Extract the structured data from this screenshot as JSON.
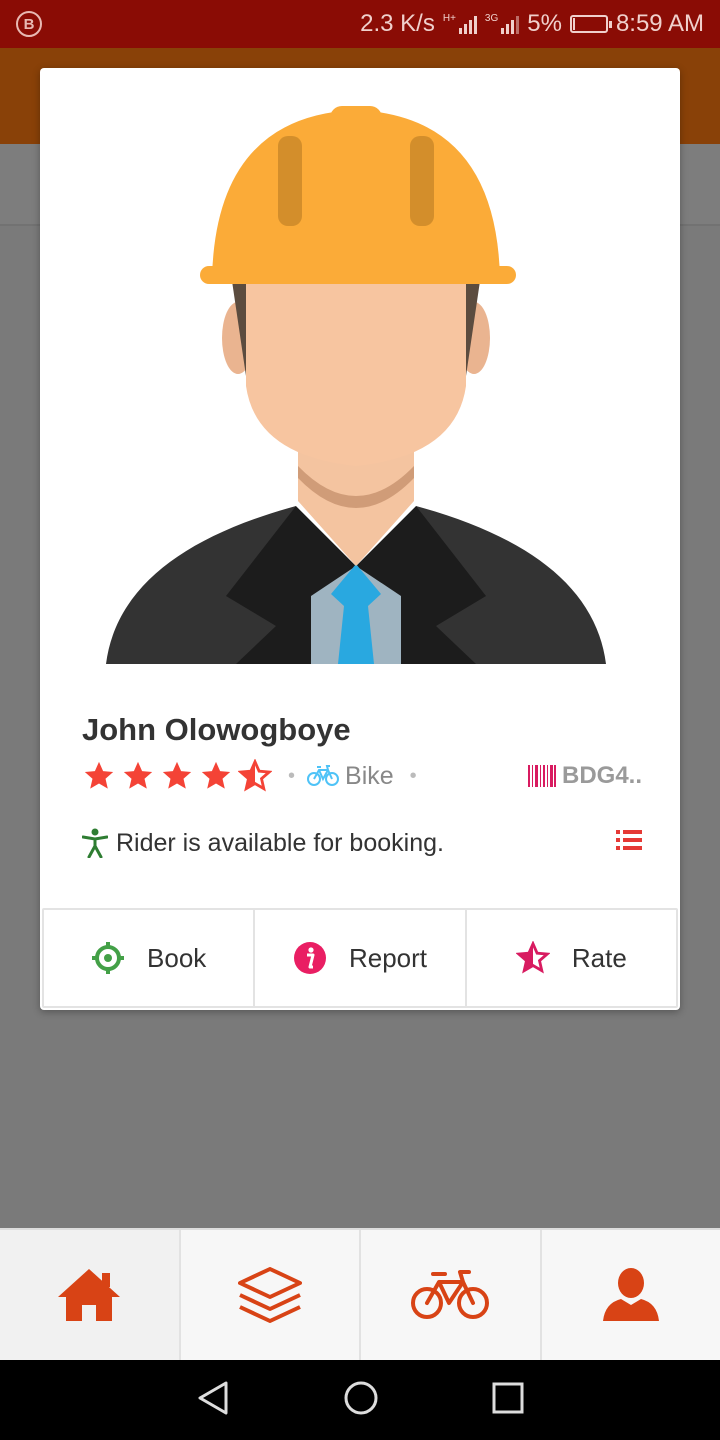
{
  "status_bar": {
    "app_badge": "B",
    "network_speed": "2.3 K/s",
    "signal1_tag": "H+",
    "signal2_tag": "3G",
    "battery": "5%",
    "time": "8:59 AM"
  },
  "rider": {
    "name": "John Olowogboye",
    "rating": 4.5,
    "vehicle_type": "Bike",
    "plate": "BDG4..",
    "availability": "Rider is available for booking."
  },
  "actions": {
    "book": "Book",
    "report": "Report",
    "rate": "Rate"
  },
  "bottom_nav": [
    "home-icon",
    "layers-icon",
    "bicycle-icon",
    "user-icon"
  ],
  "system_nav": [
    "back-icon",
    "home-circle-icon",
    "recents-icon"
  ],
  "colors": {
    "status_bar": "#8a0c05",
    "accent": "#d84315",
    "star": "#f44336",
    "book_green": "#43a047",
    "report_pink": "#e91e63",
    "vehicle_cyan": "#4fc3f7",
    "availability_green": "#2e7d32"
  }
}
